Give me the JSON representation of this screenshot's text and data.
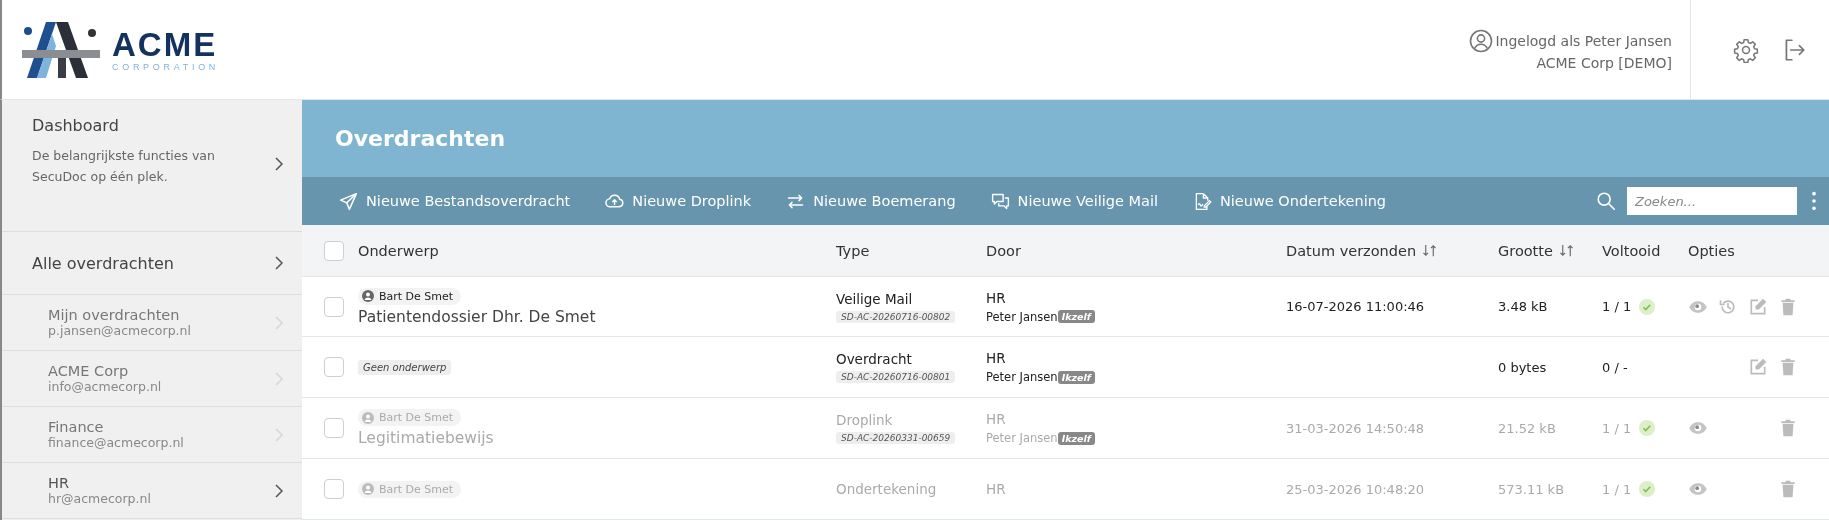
{
  "header": {
    "brand": "ACME",
    "brand_subtitle": "CORPORATION",
    "user_line": "Ingelogd als Peter Jansen",
    "org_line": "ACME Corp [DEMO]"
  },
  "sidebar": {
    "dashboard": {
      "title": "Dashboard",
      "description": "De belangrijkste functies van SecuDoc op één plek."
    },
    "all": {
      "label": "Alle overdrachten"
    },
    "items": [
      {
        "name": "Mijn overdrachten",
        "email": "p.jansen@acmecorp.nl",
        "selected": false
      },
      {
        "name": "ACME Corp",
        "email": "info@acmecorp.nl",
        "selected": false
      },
      {
        "name": "Finance",
        "email": "finance@acmecorp.nl",
        "selected": false
      },
      {
        "name": "HR",
        "email": "hr@acmecorp.nl",
        "selected": true
      }
    ]
  },
  "page": {
    "title": "Overdrachten"
  },
  "toolbar": {
    "actions": [
      {
        "kind": "send",
        "label": "Nieuwe Bestandsoverdracht"
      },
      {
        "kind": "upload",
        "label": "Nieuwe Droplink"
      },
      {
        "kind": "swap",
        "label": "Nieuwe Boemerang"
      },
      {
        "kind": "chat",
        "label": "Nieuwe Veilige Mail"
      },
      {
        "kind": "sign",
        "label": "Nieuwe Ondertekening"
      }
    ],
    "search": {
      "placeholder": "Zoeken..."
    }
  },
  "table": {
    "columns": [
      {
        "label": "Onderwerp",
        "sortable": false
      },
      {
        "label": "Type",
        "sortable": false
      },
      {
        "label": "Door",
        "sortable": false
      },
      {
        "label": "Datum verzonden",
        "sortable": true
      },
      {
        "label": "Grootte",
        "sortable": true
      },
      {
        "label": "Voltooid",
        "sortable": false
      },
      {
        "label": "Opties",
        "sortable": false
      }
    ],
    "select_all": {
      "checked": false
    },
    "rows": [
      {
        "checked": false,
        "muted": false,
        "sender": "Bart De Smet",
        "subject": "Patientendossier Dhr. De Smet",
        "type": "Veilige Mail",
        "ref": "SD-AC-20260716-00802",
        "door": "HR",
        "by": "Peter Jansen",
        "by_tag": "Ikzelf",
        "date": "16-07-2026 11:00:46",
        "size": "3.48 kB",
        "completed": "1 / 1",
        "done": true,
        "view": true,
        "history": true,
        "edit": true,
        "delete": true
      },
      {
        "checked": false,
        "muted": false,
        "no_subject": "Geen onderwerp",
        "type": "Overdracht",
        "ref": "SD-AC-20260716-00801",
        "door": "HR",
        "by": "Peter Jansen",
        "by_tag": "Ikzelf",
        "size": "0 bytes",
        "completed": "0 / -",
        "done": false,
        "view": false,
        "history": false,
        "edit": true,
        "delete": true
      },
      {
        "checked": false,
        "muted": true,
        "sender": "Bart De Smet",
        "subject": "Legitimatiebewijs",
        "type": "Droplink",
        "ref": "SD-AC-20260331-00659",
        "door": "HR",
        "by": "Peter Jansen",
        "by_tag": "Ikzelf",
        "date": "31-03-2026 14:50:48",
        "size": "21.52 kB",
        "completed": "1 / 1",
        "done": true,
        "view": true,
        "history": false,
        "edit": false,
        "delete": true
      },
      {
        "checked": false,
        "muted": true,
        "sender": "Bart De Smet",
        "type": "Ondertekening",
        "door": "HR",
        "date": "25-03-2026 10:48:20",
        "size": "573.11 kB",
        "completed": "1 / 1",
        "done": true,
        "view": true,
        "history": false,
        "edit": false,
        "delete": true
      }
    ]
  }
}
